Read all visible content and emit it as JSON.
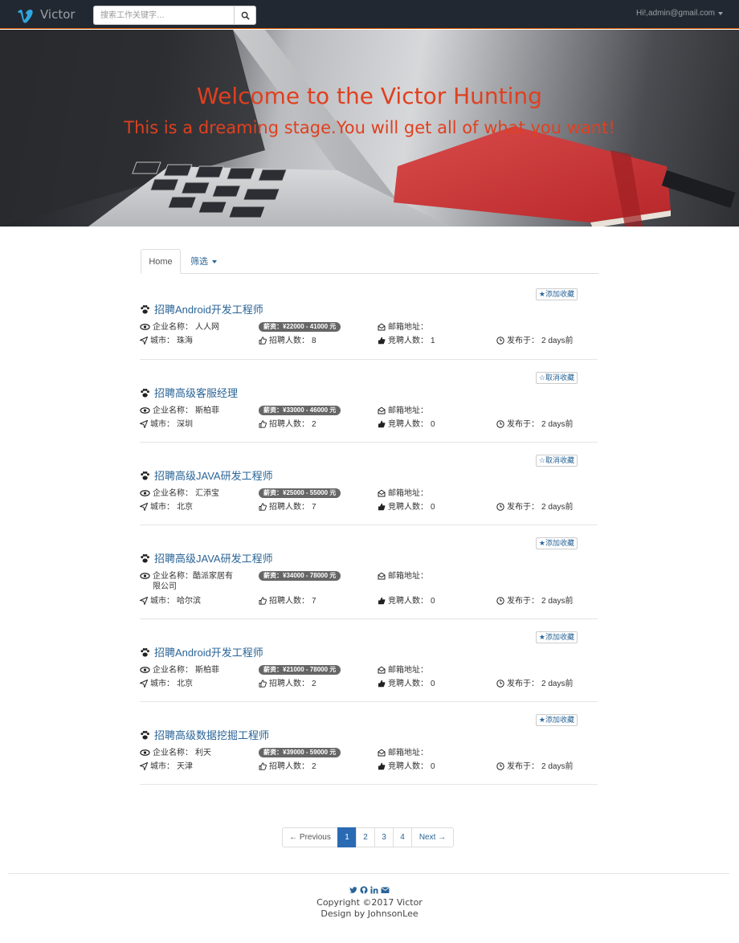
{
  "navbar": {
    "brand": "Victor",
    "search_placeholder": "搜索工作关键字...",
    "user": "Hi!,admin@gmail.com"
  },
  "hero": {
    "title": "Welcome to the Victor Hunting",
    "subtitle": "This is a dreaming stage.You will get all of what you want!"
  },
  "tabs": {
    "home": "Home",
    "filter": "筛选"
  },
  "labels": {
    "company": "企业名称：",
    "salary": "薪资：",
    "email": "邮箱地址：",
    "city": "城市：",
    "hires": "招聘人数：",
    "applicants": "竞聘人数：",
    "posted": "发布于："
  },
  "jobs": [
    {
      "title": "招聘Android开发工程师",
      "fav_label": "★添加收藏",
      "company": "人人网",
      "salary": "¥22000 - 41000 元",
      "email": "",
      "city": "珠海",
      "hires": "8",
      "applicants": "1",
      "posted": "2 days前"
    },
    {
      "title": "招聘高级客服经理",
      "fav_label": "☆取消收藏",
      "company": "斯柏菲",
      "salary": "¥33000 - 46000 元",
      "email": "",
      "city": "深圳",
      "hires": "2",
      "applicants": "0",
      "posted": "2 days前"
    },
    {
      "title": "招聘高级JAVA研发工程师",
      "fav_label": "☆取消收藏",
      "company": "汇添宝",
      "salary": "¥25000 - 55000 元",
      "email": "",
      "city": "北京",
      "hires": "7",
      "applicants": "0",
      "posted": "2 days前"
    },
    {
      "title": "招聘高级JAVA研发工程师",
      "fav_label": "★添加收藏",
      "company": "酷派家居有限公司",
      "salary": "¥34000 - 78000 元",
      "email": "",
      "city": "哈尔滨",
      "hires": "7",
      "applicants": "0",
      "posted": "2 days前"
    },
    {
      "title": "招聘Android开发工程师",
      "fav_label": "★添加收藏",
      "company": "斯柏菲",
      "salary": "¥21000 - 78000 元",
      "email": "",
      "city": "北京",
      "hires": "2",
      "applicants": "0",
      "posted": "2 days前"
    },
    {
      "title": "招聘高级数据挖掘工程师",
      "fav_label": "★添加收藏",
      "company": "利天",
      "salary": "¥39000 - 59000 元",
      "email": "",
      "city": "天津",
      "hires": "2",
      "applicants": "0",
      "posted": "2 days前"
    }
  ],
  "pagination": {
    "previous": "← Previous",
    "pages": [
      "1",
      "2",
      "3",
      "4"
    ],
    "next": "Next →",
    "current": "1"
  },
  "footer": {
    "copyright": "Copyright ©2017 Victor",
    "design": "Design by JohnsonLee",
    "social_icons": [
      "twitter-icon",
      "github-icon",
      "linkedin-icon",
      "envelope-icon"
    ]
  },
  "colors": {
    "navbar_bg": "#222831",
    "hero_text": "#e0401f",
    "link": "#2a6496",
    "active_page": "#2a6ab3"
  }
}
